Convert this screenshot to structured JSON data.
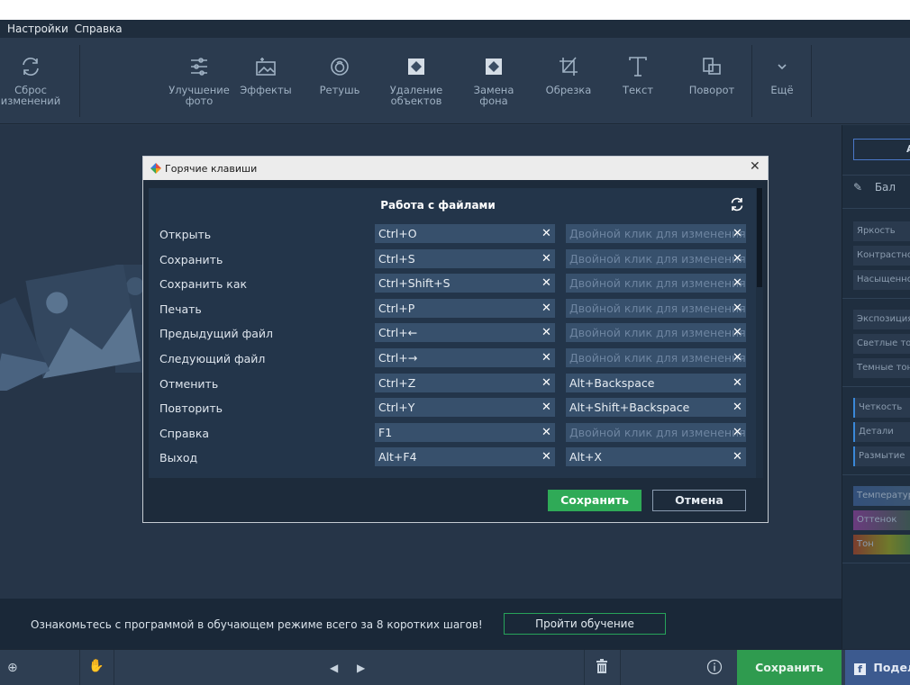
{
  "menu": {
    "settings": "Настройки",
    "help": "Справка"
  },
  "toolbar": {
    "reset": "Сброс\nизменений",
    "enhance": "Улучшение\nфото",
    "effects": "Эффекты",
    "retouch": "Ретушь",
    "remove": "Удаление\nобъектов",
    "replace_bg": "Замена\nфона",
    "crop": "Обрезка",
    "text": "Текст",
    "rotate": "Поворот",
    "more": "Ещё"
  },
  "right_panel": {
    "auto_label": "А",
    "wb_label": "Бал",
    "rows": [
      "Яркость",
      "Контрастность",
      "Насыщенность",
      "Экспозиция",
      "Светлые тона",
      "Темные тона",
      "Четкость",
      "Детали",
      "Размытие",
      "Температура",
      "Оттенок",
      "Тон"
    ]
  },
  "dialog": {
    "title": "Горячие клавиши",
    "section": "Работа с файлами",
    "empty_hint": "Двойной клик для изменения",
    "rows": [
      {
        "label": "Открыть",
        "primary": "Ctrl+O",
        "secondary": ""
      },
      {
        "label": "Сохранить",
        "primary": "Ctrl+S",
        "secondary": ""
      },
      {
        "label": "Сохранить как",
        "primary": "Ctrl+Shift+S",
        "secondary": ""
      },
      {
        "label": "Печать",
        "primary": "Ctrl+P",
        "secondary": ""
      },
      {
        "label": "Предыдущий файл",
        "primary": "Ctrl+←",
        "secondary": ""
      },
      {
        "label": "Следующий файл",
        "primary": "Ctrl+→",
        "secondary": ""
      },
      {
        "label": "Отменить",
        "primary": "Ctrl+Z",
        "secondary": "Alt+Backspace"
      },
      {
        "label": "Повторить",
        "primary": "Ctrl+Y",
        "secondary": "Alt+Shift+Backspace"
      },
      {
        "label": "Справка",
        "primary": "F1",
        "secondary": ""
      },
      {
        "label": "Выход",
        "primary": "Alt+F4",
        "secondary": "Alt+X"
      }
    ],
    "save_label": "Сохранить",
    "cancel_label": "Отмена"
  },
  "tutorial": {
    "text": "Ознакомьтесь с программой в обучающем режиме всего за 8 коротких шагов!",
    "button": "Пройти обучение"
  },
  "bottom": {
    "save": "Сохранить",
    "share": "Подел"
  },
  "colors": {
    "accent_green": "#2faa57",
    "share_blue": "#3c5a8f",
    "field_bg": "#37506c"
  }
}
